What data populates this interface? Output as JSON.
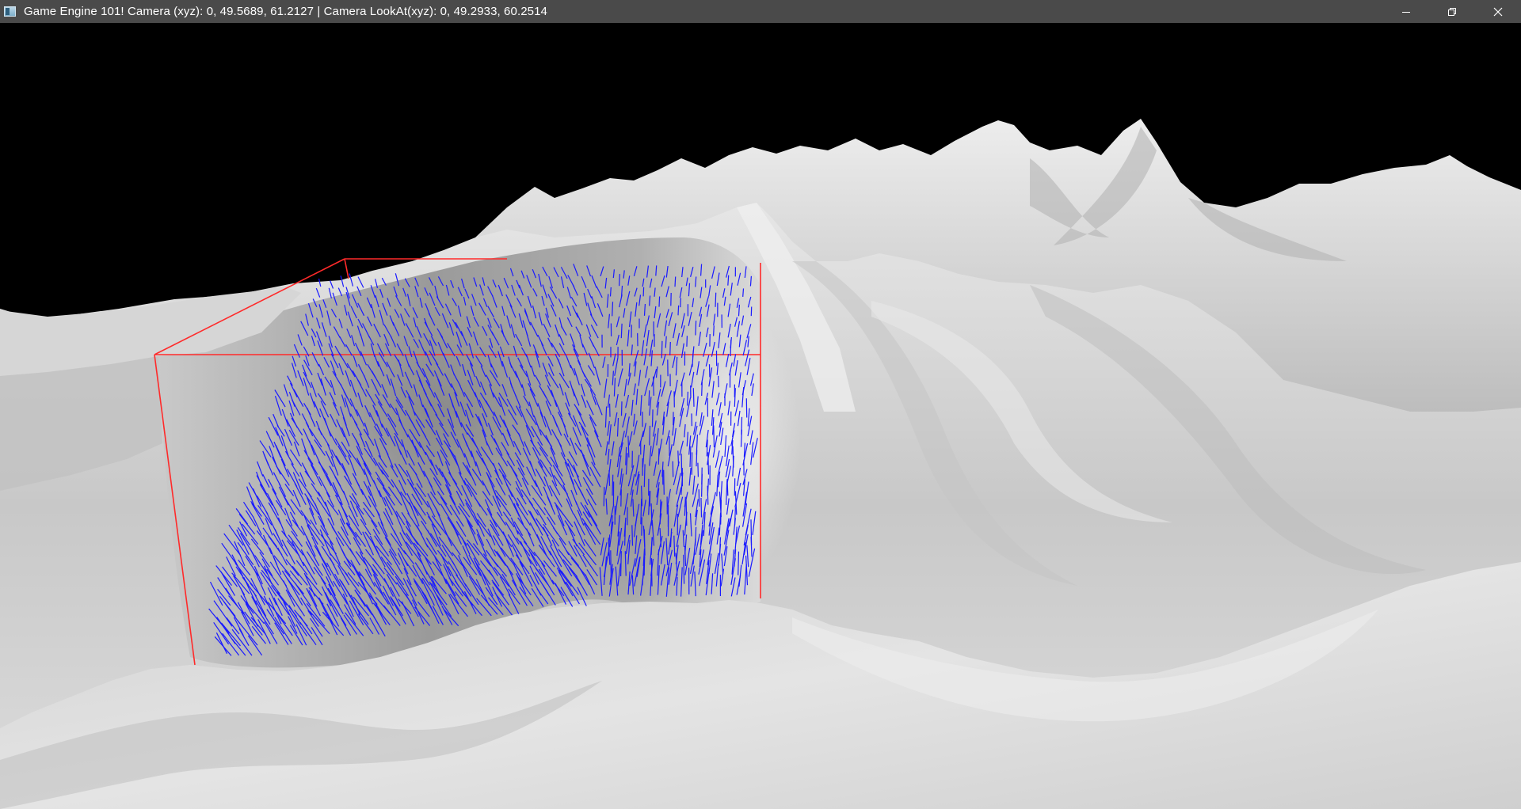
{
  "window": {
    "title": "Game Engine 101! Camera (xyz): 0, 49.5689, 61.2127 | Camera LookAt(xyz): 0, 49.2933, 60.2514",
    "app_icon": "window-app-icon",
    "controls": [
      {
        "name": "minimize",
        "icon": "minimize-icon"
      },
      {
        "name": "maximize",
        "icon": "restore-icon"
      },
      {
        "name": "close",
        "icon": "close-icon"
      }
    ]
  },
  "scene": {
    "background_color": "#000000",
    "terrain_color": "#d8d8d8",
    "terrain_shadow_color": "#8e8e8e",
    "normals_color": "#1a1aff",
    "bounding_box_color": "#ff2a2a"
  }
}
